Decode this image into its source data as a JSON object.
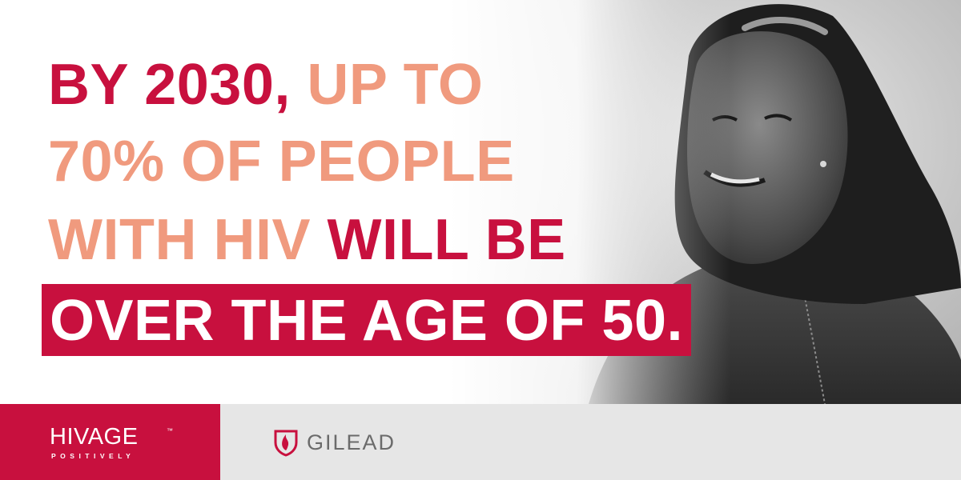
{
  "colors": {
    "dark": "#c8103e",
    "light": "#f09a7e",
    "footer_gray": "#e6e6e6"
  },
  "headline": {
    "line1_dark": "BY 2030,",
    "line1_light": "UP TO",
    "line2_light": "70% OF PEOPLE",
    "line3_light": "WITH HIV",
    "line3_dark": "WILL BE",
    "line4_highlight": "OVER THE AGE OF 50."
  },
  "footer": {
    "brand_name": "HIVAGE",
    "brand_tm": "™",
    "brand_tagline": "POSITIVELY",
    "partner_logo_icon": "gilead-flame-shield-icon",
    "partner_name": "GILEAD"
  },
  "photo": {
    "subject": "portrait-photo"
  }
}
